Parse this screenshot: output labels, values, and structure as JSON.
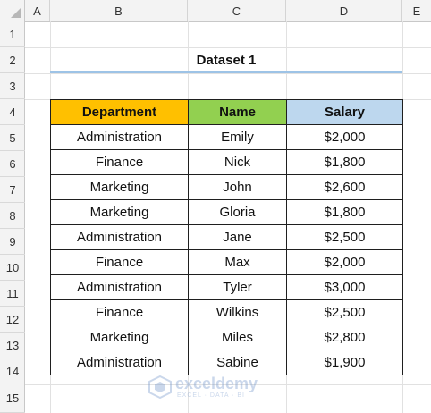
{
  "columns": [
    "A",
    "B",
    "C",
    "D",
    "E"
  ],
  "rows": [
    "1",
    "2",
    "3",
    "4",
    "5",
    "6",
    "7",
    "8",
    "9",
    "10",
    "11",
    "12",
    "13",
    "14",
    "15"
  ],
  "title": "Dataset 1",
  "table": {
    "headers": {
      "department": "Department",
      "name": "Name",
      "salary": "Salary"
    },
    "rows": [
      {
        "department": "Administration",
        "name": "Emily",
        "salary": "$2,000"
      },
      {
        "department": "Finance",
        "name": "Nick",
        "salary": "$1,800"
      },
      {
        "department": "Marketing",
        "name": "John",
        "salary": "$2,600"
      },
      {
        "department": "Marketing",
        "name": "Gloria",
        "salary": "$1,800"
      },
      {
        "department": "Administration",
        "name": "Jane",
        "salary": "$2,500"
      },
      {
        "department": "Finance",
        "name": "Max",
        "salary": "$2,000"
      },
      {
        "department": "Administration",
        "name": "Tyler",
        "salary": "$3,000"
      },
      {
        "department": "Finance",
        "name": "Wilkins",
        "salary": "$2,500"
      },
      {
        "department": "Marketing",
        "name": "Miles",
        "salary": "$2,800"
      },
      {
        "department": "Administration",
        "name": "Sabine",
        "salary": "$1,900"
      }
    ]
  },
  "watermark": {
    "brand": "exceldemy",
    "tagline": "EXCEL · DATA · BI"
  },
  "colors": {
    "department_header": "#ffc000",
    "name_header": "#92d050",
    "salary_header": "#bdd7ee",
    "title_underline": "#9dc3e6"
  }
}
